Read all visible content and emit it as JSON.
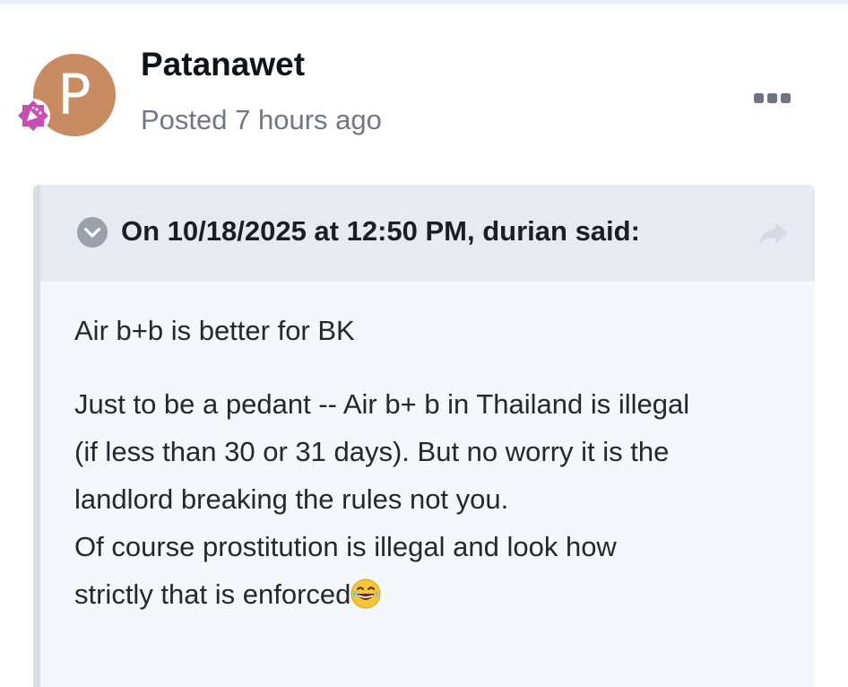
{
  "post": {
    "avatar_letter": "P",
    "author": "Patanawet",
    "meta": "Posted 7 hours ago",
    "menu_icon": "ellipsis-icon",
    "badge_icon": "rank-badge-icon"
  },
  "quote": {
    "citation": "On 10/18/2025 at 12:50 PM, durian said:",
    "collapse_icon": "chevron-down-icon",
    "share_icon": "share-arrow-icon",
    "first_line": "Air b+b is better for BK",
    "paragraph_lines": [
      "Just to be a pedant -- Air b+ b in Thailand is illegal",
      "(if less than 30 or 31 days). But no worry it is the",
      "landlord breaking the rules not you.",
      "Of course prostitution is illegal and look how",
      "strictly that is enforced"
    ],
    "emoji": "laughing-face-emoji"
  },
  "colors": {
    "avatar": "#c98b62",
    "quote_bg": "#f4f7fb",
    "quote_header_bg": "#e7ebf1",
    "badge": "#c74fb3"
  }
}
